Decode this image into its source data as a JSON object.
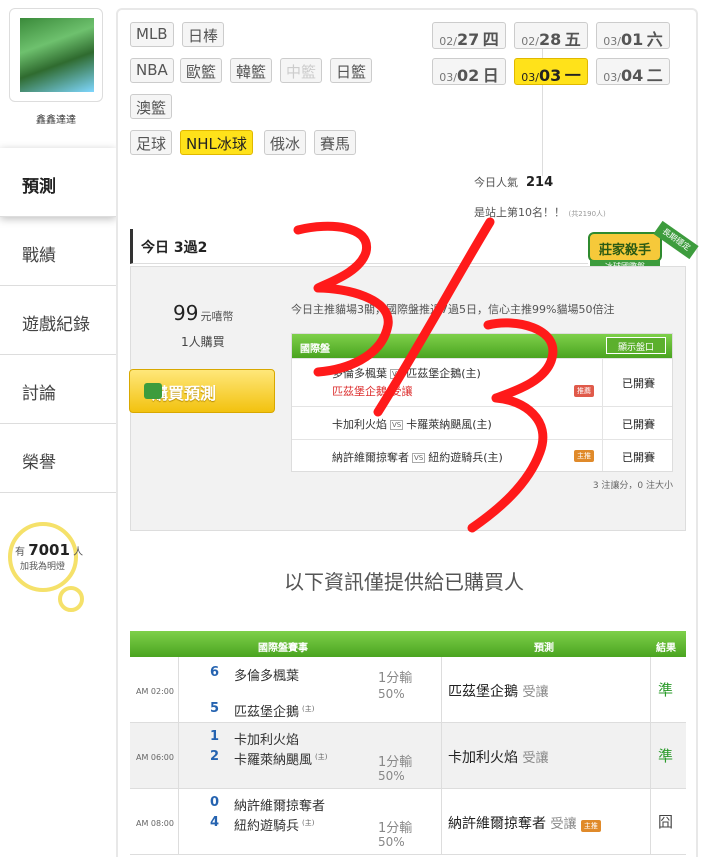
{
  "user": {
    "name": "鑫鑫達達"
  },
  "menu": [
    "預測",
    "戰績",
    "遊戲紀錄",
    "討論",
    "榮譽"
  ],
  "fans": {
    "prefix": "有",
    "count": "7001",
    "suffix": "人",
    "line2": "加我為明燈"
  },
  "sports": [
    "MLB",
    "日棒",
    "NBA",
    "歐籃",
    "韓籃",
    "中籃",
    "日籃",
    "澳籃",
    "足球",
    "NHL冰球",
    "俄冰",
    "賽馬"
  ],
  "sports_active": "NHL冰球",
  "dates": [
    {
      "md": "02/",
      "d": "27",
      "w": "四"
    },
    {
      "md": "02/",
      "d": "28",
      "w": "五"
    },
    {
      "md": "03/",
      "d": "01",
      "w": "六"
    },
    {
      "md": "03/",
      "d": "02",
      "w": "日"
    },
    {
      "md": "03/",
      "d": "03",
      "w": "一"
    },
    {
      "md": "03/",
      "d": "04",
      "w": "二"
    }
  ],
  "popularity": {
    "label": "今日人氣",
    "value": "214",
    "rank_text": "是站上第10名！！",
    "rank_note": "(共2190人)"
  },
  "badge": {
    "title": "莊家殺手",
    "sub": "冰球國際盤",
    "ribbon": "長期穩定"
  },
  "today": {
    "title": "今日 3過2"
  },
  "offer": {
    "price": "99",
    "unit": "元嘻幣",
    "buyers": "1人購買",
    "buy_label": "購買預測",
    "desc": "今日主推貓場3關，國際盤推近7過5日，信心主推99%貓場50倍注"
  },
  "inner": {
    "header": "國際盤",
    "show_label": "顯示盤口",
    "rows": [
      {
        "away": "多倫多楓葉",
        "home": "匹茲堡企鵝(主)",
        "pick": "匹茲堡企鵝",
        "pick_type": "受讓",
        "chip": "推薦",
        "result": "已開賽"
      },
      {
        "away": "卡加利火焰",
        "home": "卡羅萊納颶風(主)",
        "result": "已開賽"
      },
      {
        "away": "納許維爾掠奪者",
        "home": "紐約遊騎兵(主)",
        "chip": "主推",
        "result": "已開賽"
      }
    ],
    "footnote": "3 注讓分，0 注大小"
  },
  "info_text": "以下資訊僅提供給已購買人",
  "table": {
    "headers": {
      "game": "國際盤賽事",
      "pick": "預測",
      "result": "結果"
    },
    "rows": [
      {
        "time": "AM 02:00",
        "s1": "6",
        "t1": "多倫多楓葉",
        "s2": "5",
        "t2": "匹茲堡企鵝",
        "home_tag": "(主)",
        "odds": "1分輸",
        "pct": "50%",
        "pick": "匹茲堡企鵝",
        "pick_type": "受讓",
        "result": "準"
      },
      {
        "time": "AM 06:00",
        "s1": "1",
        "t1": "卡加利火焰",
        "s2": "2",
        "t2": "卡羅萊納颶風",
        "home_tag": "(主)",
        "odds": "1分輸",
        "pct": "50%",
        "pick": "卡加利火焰",
        "pick_type": "受讓",
        "result": "準"
      },
      {
        "time": "AM 08:00",
        "s1": "0",
        "t1": "納許維爾掠奪者",
        "s2": "4",
        "t2": "紐約遊騎兵",
        "home_tag": "(主)",
        "odds": "1分輸",
        "pct": "50%",
        "pick": "納許維爾掠奪者",
        "pick_type": "受讓",
        "chip": "主推",
        "result": "囧"
      }
    ]
  },
  "colors": {
    "accent_green": "#4aa420",
    "highlight_yellow": "#ffe21a",
    "ink_red": "#ff1a1a",
    "win_green": "#2a9a2a"
  }
}
